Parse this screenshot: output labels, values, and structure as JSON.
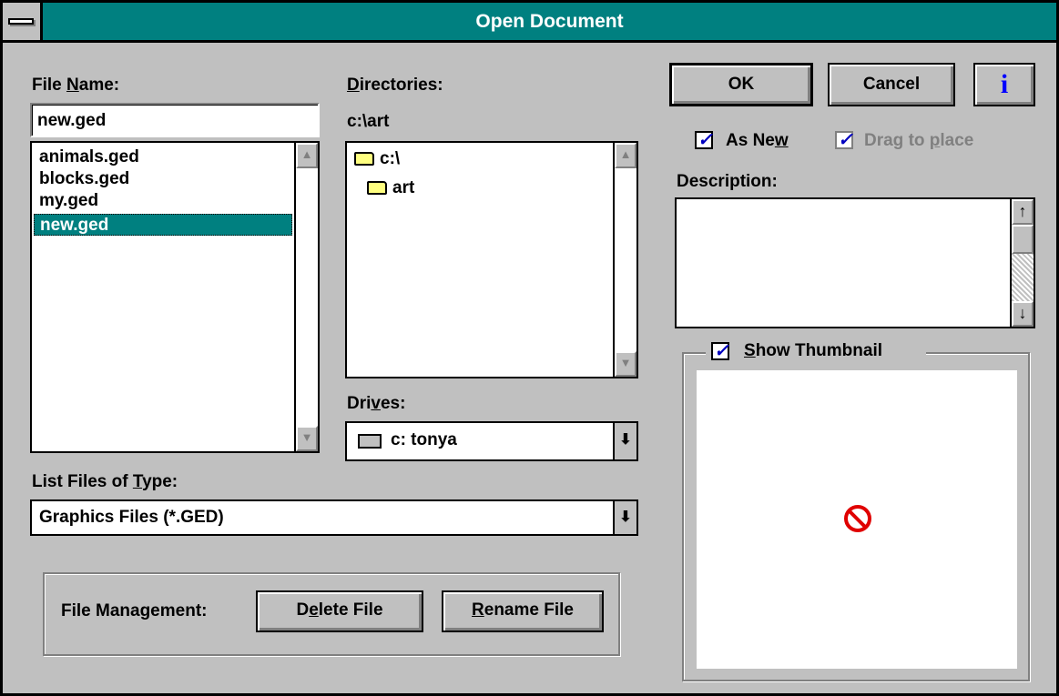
{
  "window": {
    "title": "Open Document"
  },
  "icons": {
    "system_menu": "system-menu-icon",
    "info": "info-icon",
    "folder_open": "folder-open-icon",
    "folder": "folder-icon",
    "drive": "drive-icon",
    "no_preview": "no-preview-icon",
    "scroll_up": "scroll-up-arrow-icon",
    "scroll_down": "scroll-down-arrow-icon",
    "dropdown": "dropdown-arrow-icon",
    "check": "checkmark-icon"
  },
  "colors": {
    "titlebar": "#008080",
    "selection": "#008080",
    "face": "#c0c0c0",
    "no_preview": "#e00000",
    "check": "#0000c0"
  },
  "file_name": {
    "label_pre": "File ",
    "label_u": "N",
    "label_post": "ame:",
    "value": "new.ged",
    "files": [
      {
        "name": "animals.ged",
        "selected": false
      },
      {
        "name": "blocks.ged",
        "selected": false
      },
      {
        "name": "my.ged",
        "selected": false
      },
      {
        "name": "new.ged",
        "selected": true
      }
    ],
    "scroll_up": "▲",
    "scroll_down": "▼"
  },
  "directories": {
    "label_u": "D",
    "label_post": "irectories:",
    "current_path": "c:\\art",
    "items": [
      {
        "name": "c:\\",
        "icon": "folder-open-icon"
      },
      {
        "name": "art",
        "icon": "folder-open-icon"
      }
    ],
    "scroll_up": "▲",
    "scroll_down": "▼"
  },
  "drives": {
    "label_pre": "Dri",
    "label_u": "v",
    "label_post": "es:",
    "value": "c: tonya",
    "arrow": "⬇"
  },
  "file_type": {
    "label_pre": "List Files of ",
    "label_u": "T",
    "label_post": "ype:",
    "value": "Graphics Files (*.GED)",
    "arrow": "⬇"
  },
  "file_management": {
    "label": "File Management:",
    "delete_pre": "D",
    "delete_u": "e",
    "delete_post": "lete File",
    "rename_u": "R",
    "rename_post": "ename File"
  },
  "buttons": {
    "ok": "OK",
    "cancel": "Cancel",
    "info": "i"
  },
  "options": {
    "as_new_pre": "As Ne",
    "as_new_u": "w",
    "as_new_checked": true,
    "check_glyph": "✓",
    "drag_pre": "Drag to ",
    "drag_u": "p",
    "drag_post": "lace",
    "drag_checked": true,
    "drag_enabled": false
  },
  "description": {
    "label": "Description:",
    "value": "",
    "scroll_up": "↑",
    "scroll_down": "↓"
  },
  "thumbnail": {
    "label_u": "S",
    "label_post": "how Thumbnail",
    "checked": true,
    "preview_symbol": "🛇"
  }
}
